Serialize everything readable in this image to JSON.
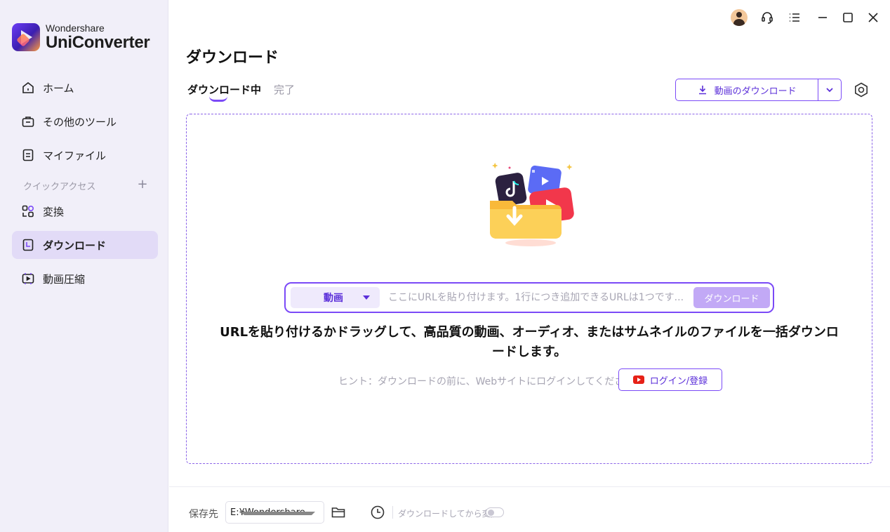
{
  "app": {
    "brand_small": "Wondershare",
    "brand_big": "UniConverter"
  },
  "sidebar": {
    "items": [
      {
        "label": "ホーム",
        "icon": "home-icon"
      },
      {
        "label": "その他のツール",
        "icon": "toolbox-icon"
      },
      {
        "label": "マイファイル",
        "icon": "file-icon"
      }
    ],
    "quick_access_label": "クイックアクセス",
    "quick_items": [
      {
        "label": "変換",
        "icon": "convert-icon"
      },
      {
        "label": "ダウンロード",
        "icon": "download-icon",
        "active": true
      },
      {
        "label": "動画圧縮",
        "icon": "compress-icon"
      }
    ],
    "accent": "#7b4af7"
  },
  "header": {
    "title": "ダウンロード",
    "tabs": [
      {
        "label": "ダウンロード中",
        "active": true
      },
      {
        "label": "完了",
        "active": false
      }
    ],
    "download_button_label": "動画のダウンロード"
  },
  "main": {
    "url_type": "動画",
    "url_placeholder": "ここにURLを貼り付けます。1行につき追加できるURLは1つです...",
    "url_button": "ダウンロード",
    "headline": "URLを貼り付けるかドラッグして、高品質の動画、オーディオ、またはサムネイルのファイルを一括ダウンロードします。",
    "hint": "ヒント：ダウンロードの前に、Webサイトにログインしてください。",
    "login_button": "ログイン/登録"
  },
  "footer": {
    "save_label": "保存先",
    "save_path": "E:¥Wondershare UniConverter",
    "convert_label": "ダウンロードしてから変換:",
    "convert_enabled": false
  }
}
